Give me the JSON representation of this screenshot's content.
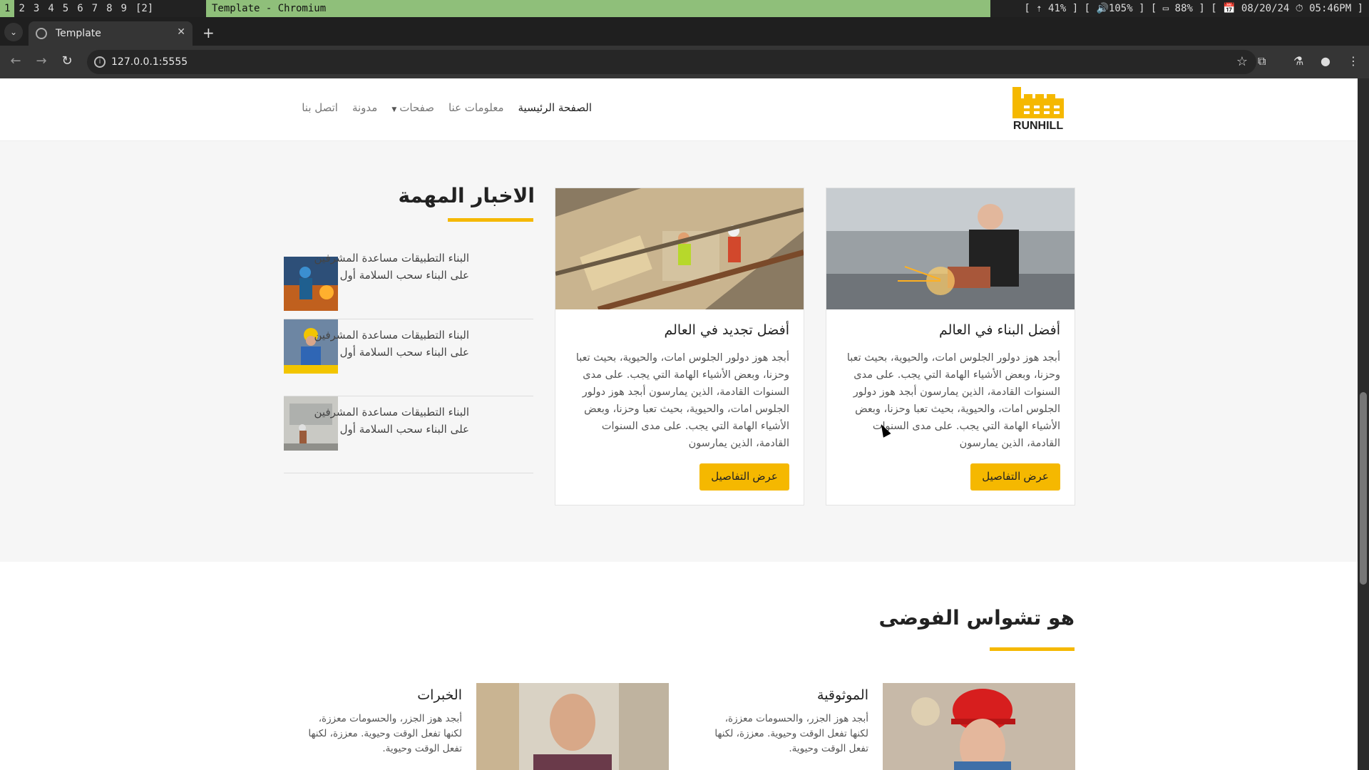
{
  "wm": {
    "workspaces": [
      "1",
      "2",
      "3",
      "4",
      "5",
      "6",
      "7",
      "8",
      "9",
      "[2]"
    ],
    "active_workspace": "1",
    "window_title": "Template - Chromium",
    "status": "[ ⇡ 41% ] [ 🔊105% ] [ ▭ 88% ] [ 📅 08/20/24 ⏱ 05:46PM ]"
  },
  "browser": {
    "tab_title": "Template",
    "tab_close": "✕",
    "new_tab": "+",
    "url": "127.0.0.1:5555"
  },
  "site": {
    "logo_text": "RUNHILL",
    "nav": {
      "home": "الصفحة الرئيسية",
      "about": "معلومات عنا",
      "pages": "صفحات",
      "blog": "مدونة",
      "contact": "اتصل بنا"
    }
  },
  "news": {
    "title": "الاخبار المهمة",
    "items": [
      {
        "text": "البناء التطبيقات مساعدة المشرفين على البناء سحب السلامة أول"
      },
      {
        "text": "البناء التطبيقات مساعدة المشرفين على البناء سحب السلامة أول"
      },
      {
        "text": "البناء التطبيقات مساعدة المشرفين على البناء سحب السلامة أول"
      }
    ],
    "cards": [
      {
        "title": "أفضل البناء في العالم",
        "body": "أبجد هوز دولور الجلوس امات، والحيوية، بحيث تعبا وحزنا، وبعض الأشياء الهامة التي يجب. على مدى السنوات القادمة، الذين يمارسون أبجد هوز دولور الجلوس امات، والحيوية، بحيث تعبا وحزنا، وبعض الأشياء الهامة التي يجب. على مدى السنوات القادمة، الذين يمارسون",
        "button": "عرض التفاصيل"
      },
      {
        "title": "أفضل تجديد في العالم",
        "body": "أبجد هوز دولور الجلوس امات، والحيوية، بحيث تعبا وحزنا، وبعض الأشياء الهامة التي يجب. على مدى السنوات القادمة، الذين يمارسون أبجد هوز دولور الجلوس امات، والحيوية، بحيث تعبا وحزنا، وبعض الأشياء الهامة التي يجب. على مدى السنوات القادمة، الذين يمارسون",
        "button": "عرض التفاصيل"
      }
    ]
  },
  "chaos": {
    "title": "هو تشواس الفوضى",
    "features": [
      {
        "title": "الموثوقية",
        "text": "أبجد هوز الجزر، والحسومات معززة، لكنها تفعل الوقت وحيوية. معززة، لكنها تفعل الوقت وحيوية."
      },
      {
        "title": "الخبرات",
        "text": "أبجد هوز الجزر، والحسومات معززة، لكنها تفعل الوقت وحيوية. معززة، لكنها تفعل الوقت وحيوية."
      }
    ]
  },
  "colors": {
    "accent": "#f5b800",
    "wm_green": "#8fbf7a"
  }
}
